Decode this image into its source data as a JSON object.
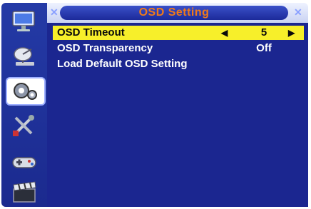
{
  "title": "OSD Setting",
  "sidebar": {
    "items": [
      {
        "icon": "monitor-icon"
      },
      {
        "icon": "satellite-dish-icon"
      },
      {
        "icon": "settings-gears-icon",
        "active": true
      },
      {
        "icon": "tools-icon"
      },
      {
        "icon": "gamepad-icon"
      },
      {
        "icon": "clapperboard-icon"
      }
    ]
  },
  "menu": {
    "items": [
      {
        "label": "OSD Timeout",
        "value": "5",
        "arrow_left": "◀",
        "arrow_right": "▶",
        "selected": true
      },
      {
        "label": "OSD Transparency",
        "value": "Off"
      },
      {
        "label": "Load Default OSD Setting"
      }
    ]
  },
  "colors": {
    "background": "#1b2690",
    "highlight": "#f7ef2a",
    "title_text": "#f07a1a"
  }
}
